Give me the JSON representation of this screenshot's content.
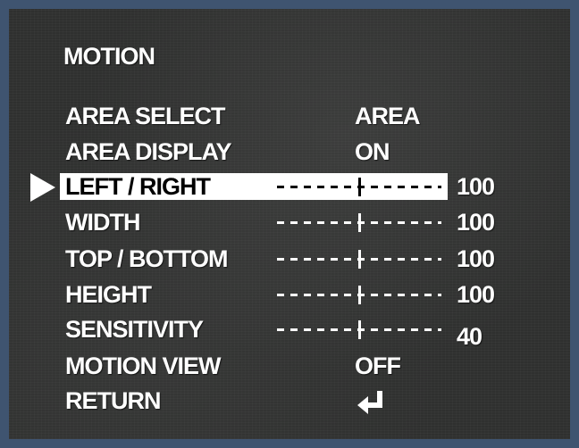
{
  "menu": {
    "title": "MOTION",
    "area_select": {
      "label": "AREA SELECT",
      "value": "AREA"
    },
    "area_display": {
      "label": "AREA DISPLAY",
      "value": "ON"
    },
    "left_right": {
      "label": "LEFT / RIGHT",
      "value": "100",
      "level": 0.5
    },
    "width": {
      "label": "WIDTH",
      "value": "100",
      "level": 0.5
    },
    "top_bottom": {
      "label": "TOP / BOTTOM",
      "value": "100",
      "level": 0.5
    },
    "height": {
      "label": "HEIGHT",
      "value": "100",
      "level": 0.5
    },
    "sensitivity": {
      "label": "SENSITIVITY",
      "value": "40",
      "level": 0.5
    },
    "motion_view": {
      "label": "MOTION VIEW",
      "value": "OFF"
    },
    "return": {
      "label": "RETURN",
      "icon": "enter-return-icon"
    },
    "selected_item": "left_right"
  },
  "colors": {
    "border": "#3f5470",
    "background": "#2f302f",
    "text": "#ffffff",
    "highlight": "#ffffff"
  }
}
